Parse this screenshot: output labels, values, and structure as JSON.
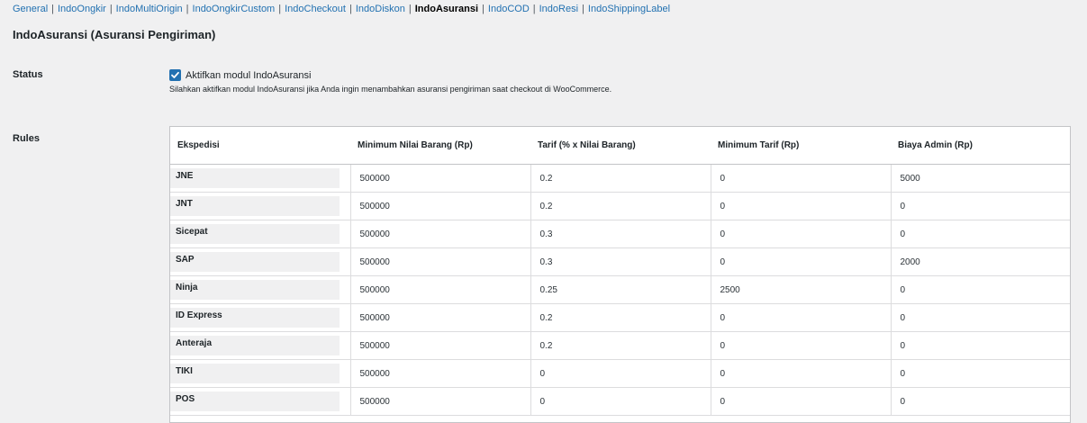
{
  "nav": {
    "items": [
      {
        "label": "General",
        "current": false
      },
      {
        "label": "IndoOngkir",
        "current": false
      },
      {
        "label": "IndoMultiOrigin",
        "current": false
      },
      {
        "label": "IndoOngkirCustom",
        "current": false
      },
      {
        "label": "IndoCheckout",
        "current": false
      },
      {
        "label": "IndoDiskon",
        "current": false
      },
      {
        "label": "IndoAsuransi",
        "current": true
      },
      {
        "label": "IndoCOD",
        "current": false
      },
      {
        "label": "IndoResi",
        "current": false
      },
      {
        "label": "IndoShippingLabel",
        "current": false
      }
    ],
    "separator": "|"
  },
  "page_title": "IndoAsuransi (Asuransi Pengiriman)",
  "status": {
    "label": "Status",
    "checkbox_label": "Aktifkan modul IndoAsuransi",
    "checked": true,
    "description": "Silahkan aktifkan modul IndoAsuransi jika Anda ingin menambahkan asuransi pengiriman saat checkout di WooCommerce."
  },
  "rules": {
    "label": "Rules",
    "headers": [
      "Ekspedisi",
      "Minimum Nilai Barang (Rp)",
      "Tarif (% x Nilai Barang)",
      "Minimum Tarif (Rp)",
      "Biaya Admin (Rp)"
    ],
    "rows": [
      {
        "courier": "JNE",
        "values": [
          "500000",
          "0.2",
          "0",
          "5000"
        ]
      },
      {
        "courier": "JNT",
        "values": [
          "500000",
          "0.2",
          "0",
          "0"
        ]
      },
      {
        "courier": "Sicepat",
        "values": [
          "500000",
          "0.3",
          "0",
          "0"
        ]
      },
      {
        "courier": "SAP",
        "values": [
          "500000",
          "0.3",
          "0",
          "2000"
        ]
      },
      {
        "courier": "Ninja",
        "values": [
          "500000",
          "0.25",
          "2500",
          "0"
        ]
      },
      {
        "courier": "ID Express",
        "values": [
          "500000",
          "0.2",
          "0",
          "0"
        ]
      },
      {
        "courier": "Anteraja",
        "values": [
          "500000",
          "0.2",
          "0",
          "0"
        ]
      },
      {
        "courier": "TIKI",
        "values": [
          "500000",
          "0",
          "0",
          "0"
        ]
      },
      {
        "courier": "POS",
        "values": [
          "500000",
          "0",
          "0",
          "0"
        ]
      }
    ]
  },
  "colors": {
    "link": "#2271b1",
    "checkbox": "#2271b1",
    "background": "#f0f0f1"
  }
}
